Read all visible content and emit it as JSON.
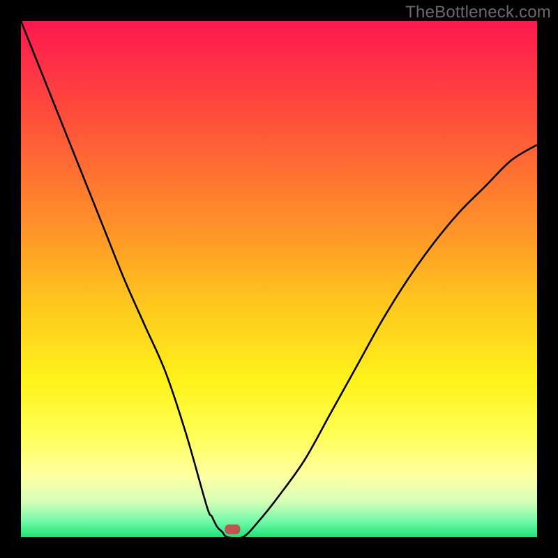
{
  "watermark": "TheBottleneck.com",
  "chart_data": {
    "type": "line",
    "title": "",
    "xlabel": "",
    "ylabel": "",
    "xlim": [
      0,
      100
    ],
    "ylim": [
      0,
      100
    ],
    "grid": false,
    "legend": false,
    "background_gradient": {
      "stops": [
        {
          "offset": 0.0,
          "color": "#ff1750"
        },
        {
          "offset": 0.2,
          "color": "#ff5339"
        },
        {
          "offset": 0.4,
          "color": "#ff9229"
        },
        {
          "offset": 0.55,
          "color": "#ffc81d"
        },
        {
          "offset": 0.7,
          "color": "#fff31b"
        },
        {
          "offset": 0.8,
          "color": "#ffff55"
        },
        {
          "offset": 0.88,
          "color": "#ffffa0"
        },
        {
          "offset": 0.93,
          "color": "#d8ffb8"
        },
        {
          "offset": 0.97,
          "color": "#70f9a8"
        },
        {
          "offset": 1.0,
          "color": "#1ce576"
        }
      ]
    },
    "series": [
      {
        "name": "bottleneck-curve",
        "x": [
          0,
          4,
          8,
          12,
          16,
          20,
          24,
          28,
          32,
          36,
          37,
          38,
          39,
          40,
          43,
          46,
          50,
          55,
          60,
          65,
          70,
          75,
          80,
          85,
          90,
          95,
          100
        ],
        "y": [
          100,
          90,
          80,
          70,
          60,
          50,
          41,
          32,
          20,
          6,
          4,
          2,
          1,
          0,
          0,
          3,
          8,
          15,
          24,
          33,
          42,
          50,
          57,
          63,
          68,
          73,
          76
        ]
      }
    ],
    "marker": {
      "name": "optimal-point",
      "x": 41,
      "y": 1.5,
      "shape": "rounded-rect",
      "color": "#c1524e"
    }
  }
}
